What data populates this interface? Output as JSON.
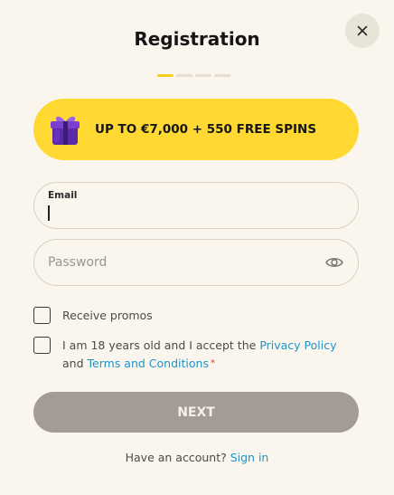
{
  "dialog": {
    "title": "Registration",
    "close_icon": "close-icon",
    "steps": {
      "total": 4,
      "current": 1
    }
  },
  "promo": {
    "icon": "gift-icon",
    "text": "UP TO €7,000 + 550 FREE SPINS",
    "background": "#ffd932"
  },
  "form": {
    "email": {
      "label": "Email",
      "value": ""
    },
    "password": {
      "placeholder": "Password",
      "value": "",
      "toggle_icon": "eye-icon"
    },
    "promos_checkbox": {
      "label": "Receive promos",
      "checked": false
    },
    "terms_checkbox": {
      "text_prefix": "I am 18 years old and I accept the",
      "privacy_link": "Privacy Policy",
      "text_and": "and",
      "terms_link": "Terms and Conditions",
      "required_mark": "*",
      "checked": false
    },
    "next_button": "NEXT"
  },
  "footer": {
    "question": "Have an account?",
    "signin_link": "Sign in"
  },
  "colors": {
    "background": "#faf6ee",
    "accent": "#f7cf22",
    "link": "#1e94c9",
    "button_disabled": "#a29c94"
  }
}
